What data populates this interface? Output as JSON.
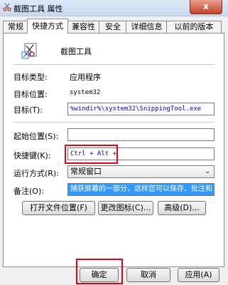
{
  "window": {
    "title": "截图工具 属性",
    "close_label": "x"
  },
  "tabs": [
    {
      "label": "常规"
    },
    {
      "label": "快捷方式"
    },
    {
      "label": "兼容性"
    },
    {
      "label": "安全"
    },
    {
      "label": "详细信息"
    },
    {
      "label": "以前的版本"
    }
  ],
  "shortcut": {
    "name": "截图工具",
    "target_type_label": "目标类型:",
    "target_type_value": "应用程序",
    "target_location_label": "目标位置:",
    "target_location_value": "system32",
    "target_label": "目标(T):",
    "target_value": "%windir%\\system32\\SnippingTool.exe",
    "start_in_label": "起始位置(S):",
    "start_in_value": "",
    "hotkey_label": "快捷键(K):",
    "hotkey_value": "Ctrl + Alt +",
    "run_label": "运行方式(R):",
    "run_value": "常规窗口",
    "comment_label": "备注(O):",
    "comment_value": "捕获屏幕的一部分，这样您可以保存、批注和",
    "open_location_button": "打开文件位置(F)",
    "change_icon_button": "更改图标(C)...",
    "advanced_button": "高级(D)..."
  },
  "footer": {
    "ok": "确定",
    "cancel": "取消",
    "apply": "应用(A)"
  },
  "colors": {
    "highlight": "#e60012",
    "selection": "#3399ff"
  }
}
